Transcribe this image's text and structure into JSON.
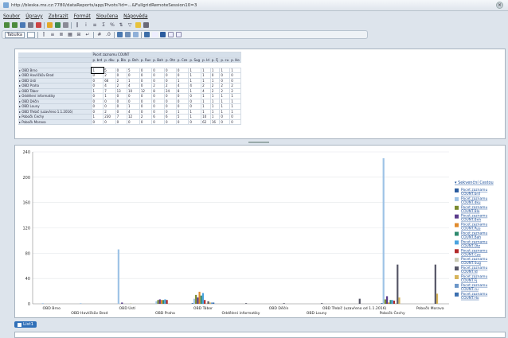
{
  "window": {
    "url": "http://bleska.ms.cz:7780/dataReports/app/Pivots?id=...&FullgridRemoteSession10=3"
  },
  "menubar": [
    "Soubor",
    "Úpravy",
    "Zobrazit",
    "Formát",
    "Sloučena",
    "Nápověda"
  ],
  "toolbar": {
    "zoom": "Tabulka"
  },
  "pivot": {
    "col_header_title": "Pocet zaznamu COUNT",
    "columns": [
      "p. brd",
      "p. dku",
      "p. Blo",
      "p. Bnh",
      "p. Rus",
      "p. Bah",
      "p. Otz",
      "p. Cze",
      "p. Sug",
      "p. Id",
      "p. Fj",
      "p. cu",
      "p. Ho"
    ],
    "rows": [
      {
        "label": "OBD Brno",
        "values": [
          "1",
          "5",
          "0",
          "5",
          "0",
          "0",
          "0",
          "0",
          "1",
          "1",
          "1",
          "1",
          "1"
        ]
      },
      {
        "label": "OBD Havlíčkův Brod",
        "values": [
          "0",
          "2",
          "0",
          "0",
          "0",
          "0",
          "0",
          "0",
          "1",
          "1",
          "0",
          "0",
          "0"
        ]
      },
      {
        "label": "OBD Ústí",
        "values": [
          "0",
          "66",
          "2",
          "1",
          "0",
          "0",
          "0",
          "1",
          "1",
          "1",
          "1",
          "0",
          "0"
        ]
      },
      {
        "label": "OBD Praha",
        "values": [
          "0",
          "4",
          "2",
          "4",
          "0",
          "2",
          "2",
          "4",
          "4",
          "2",
          "2",
          "2",
          "2"
        ]
      },
      {
        "label": "OBD Tábor",
        "values": [
          "1",
          "7",
          "13",
          "10",
          "12",
          "8",
          "24",
          "8",
          "1",
          "4",
          "2",
          "2",
          "2"
        ]
      },
      {
        "label": "Oddělení informatiky",
        "values": [
          "0",
          "1",
          "0",
          "0",
          "0",
          "0",
          "0",
          "0",
          "0",
          "1",
          "1",
          "1",
          "1"
        ]
      },
      {
        "label": "OBD Děčín",
        "values": [
          "0",
          "0",
          "0",
          "0",
          "0",
          "0",
          "0",
          "0",
          "0",
          "1",
          "1",
          "1",
          "1"
        ]
      },
      {
        "label": "OBD Louny",
        "values": [
          "0",
          "0",
          "0",
          "1",
          "0",
          "0",
          "0",
          "0",
          "0",
          "1",
          "1",
          "1",
          "1"
        ]
      },
      {
        "label": "OBD Třebíč (uzavřeno 1.1.2016)",
        "values": [
          "0",
          "2",
          "0",
          "4",
          "0",
          "0",
          "0",
          "1",
          "1",
          "1",
          "1",
          "1",
          "1"
        ]
      },
      {
        "label": "Pobočk Čechy",
        "values": [
          "1",
          "230",
          "7",
          "12",
          "2",
          "6",
          "6",
          "5",
          "1",
          "10",
          "1",
          "0",
          "0"
        ]
      },
      {
        "label": "Pobočk Morava",
        "values": [
          "0",
          "0",
          "0",
          "0",
          "0",
          "0",
          "0",
          "0",
          "0",
          "62",
          "16",
          "0",
          "0"
        ]
      }
    ]
  },
  "chart_data": {
    "type": "bar",
    "ylim": [
      0,
      240
    ],
    "yticks": [
      0,
      40,
      80,
      120,
      160,
      200,
      240
    ],
    "categories": [
      "OBD Brno",
      "OBD Havlíčkův Brod",
      "OBD Ústí",
      "OBD Praha",
      "OBD Tábor",
      "Oddělení informatiky",
      "OBD Děčín",
      "OBD Louny",
      "OBD Třebíč (uzavřeno od 1.1.2016)",
      "Pobočk Čechy",
      "Pobočk Morava"
    ],
    "series": [
      {
        "name": "Pocet zaznamu COUNT.brd",
        "color": "#2b5c9e",
        "values": [
          0,
          0,
          0,
          0,
          1,
          0,
          0,
          0,
          0,
          1,
          0
        ]
      },
      {
        "name": "Pocet zaznamu COUNT.dku",
        "color": "#9ec3e6",
        "values": [
          1,
          1,
          86,
          4,
          8,
          0,
          0,
          0,
          0,
          230,
          0
        ]
      },
      {
        "name": "Pocet zaznamu COUNT.Blo",
        "color": "#7a8a2e",
        "values": [
          0,
          0,
          0,
          6,
          14,
          0,
          0,
          0,
          0,
          7,
          0
        ]
      },
      {
        "name": "Pocet zaznamu COUNT.Bnh",
        "color": "#5b3c8c",
        "values": [
          0,
          0,
          2,
          7,
          10,
          0,
          0,
          0,
          0,
          12,
          0
        ]
      },
      {
        "name": "Pocet zaznamu COUNT.Rus",
        "color": "#e08a2c",
        "values": [
          0,
          0,
          0,
          6,
          19,
          0,
          0,
          0,
          0,
          2,
          0
        ]
      },
      {
        "name": "Pocet zaznamu COUNT.Bah",
        "color": "#2e8a6e",
        "values": [
          0,
          0,
          0,
          6,
          13,
          0,
          0,
          0,
          0,
          6,
          0
        ]
      },
      {
        "name": "Pocet zaznamu COUNT.Otz",
        "color": "#4aa3df",
        "values": [
          0,
          0,
          0,
          7,
          17,
          0,
          0,
          0,
          0,
          6,
          0
        ]
      },
      {
        "name": "Pocet zaznamu COUNT.Cze",
        "color": "#b22a2a",
        "values": [
          0,
          0,
          0,
          6,
          6,
          0,
          0,
          0,
          0,
          5,
          0
        ]
      },
      {
        "name": "Pocet zaznamu COUNT.Sug",
        "color": "#c8c8b0",
        "values": [
          0,
          0,
          1,
          0,
          1,
          0,
          0,
          0,
          0,
          1,
          0
        ]
      },
      {
        "name": "Pocet zaznamu COUNT.Id",
        "color": "#555566",
        "values": [
          0,
          0,
          0,
          0,
          4,
          1,
          1,
          1,
          8,
          62,
          62
        ]
      },
      {
        "name": "Pocet zaznamu COUNT.Fj",
        "color": "#d7b45a",
        "values": [
          0,
          0,
          0,
          0,
          2,
          0,
          0,
          0,
          0,
          10,
          16
        ]
      },
      {
        "name": "Pocet zaznamu COUNT.cu",
        "color": "#6b96c8",
        "values": [
          0,
          0,
          0,
          0,
          2,
          0,
          0,
          0,
          0,
          0,
          0
        ]
      },
      {
        "name": "Pocet zaznamu COUNT.Ho",
        "color": "#3b6fb0",
        "values": [
          0,
          0,
          0,
          0,
          2,
          0,
          0,
          0,
          0,
          0,
          0
        ]
      }
    ],
    "legend_title": "Sekvenční Cestou"
  },
  "sheet_tab": "List1"
}
